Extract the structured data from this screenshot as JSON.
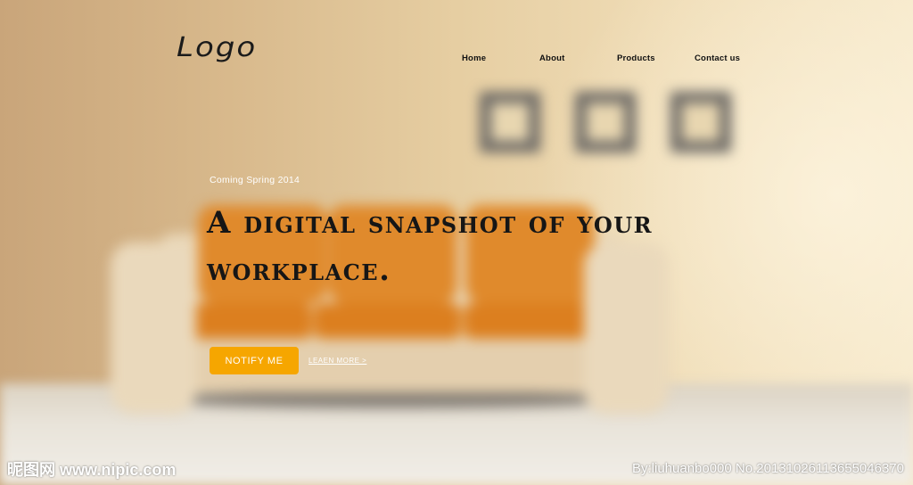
{
  "header": {
    "logo_text": "Logo"
  },
  "nav": {
    "items": [
      {
        "label": "Home"
      },
      {
        "label": "About"
      },
      {
        "label": "Products"
      },
      {
        "label": "Contact us"
      }
    ]
  },
  "hero": {
    "tagline": "Coming Spring 2014",
    "headline": "A digital snapshot of your workplace.",
    "notify_button": "NOTIFY ME",
    "learn_more": "LEAEN MORE >"
  },
  "watermark": {
    "left": "昵图网 www.nipic.com",
    "right": "By:liuhuanbo000  No.20131026113655046370"
  },
  "colors": {
    "accent": "#f6a600",
    "sofa_cushion": "#e08a2c",
    "wall": "#e6cea2"
  }
}
